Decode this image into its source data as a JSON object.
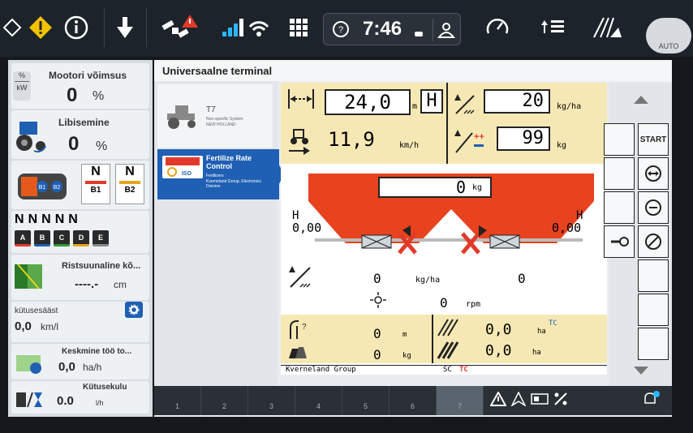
{
  "topbar": {
    "time": "7:46",
    "auto_label": "AUTO"
  },
  "left_panel": {
    "engine_load": {
      "title": "Mootori võimsus",
      "value": "0",
      "unit": "%",
      "badge_top": "%",
      "badge_bottom": "kW"
    },
    "slip": {
      "title": "Libisemine",
      "value": "0",
      "unit": "%"
    },
    "brakes": {
      "b1_label": "B1",
      "b2_label": "B2",
      "b1_state": "N",
      "b2_state": "N",
      "badge1": "B1",
      "badge2": "B2"
    },
    "remotes": {
      "states": [
        "N",
        "N",
        "N",
        "N",
        "N"
      ],
      "letters": [
        "A",
        "B",
        "C",
        "D",
        "E"
      ]
    },
    "crosstrack": {
      "title": "Ristsuunaline kõ...",
      "value": "----.-",
      "unit": "cm"
    },
    "fuel_setting": {
      "title": "kütusesääst",
      "value": "0,0",
      "unit": "km/l"
    },
    "avg_work": {
      "title": "Keskmine töö to...",
      "value": "0,0",
      "unit": "ha/h"
    },
    "fuel_use": {
      "title": "Kütusekulu",
      "value": "0.0",
      "unit": "l/h"
    }
  },
  "main": {
    "header": "Universaalne terminal",
    "apps": [
      {
        "name": "T7",
        "line1": "Non-specific System",
        "line2": "NEW HOLLAND"
      },
      {
        "name": "Fertilize Rate Control",
        "line1": "Fertilizers",
        "line2": "Kverneland Group, Electronics Division",
        "badge": "ISO"
      }
    ]
  },
  "terminal": {
    "width_value": "24,0",
    "width_unit": "m",
    "width_mode": "H",
    "speed_value": "11,9",
    "speed_unit": "km/h",
    "rate_value": "20",
    "rate_unit": "kg/ha",
    "rate2_value": "99",
    "rate2_unit": "kg",
    "hopper_value": "0",
    "hopper_unit": "kg",
    "left_H": "H",
    "left_H_val": "0,00",
    "right_H": "H",
    "right_H_val": "0,00",
    "applied_rate": "0",
    "applied_rate_unit": "kg/ha",
    "applied_right": "0",
    "disc_speed": "0",
    "disc_unit": "rpm",
    "dist_value": "0",
    "dist_unit": "m",
    "mass_value": "0",
    "mass_unit": "kg",
    "area1_value": "0,0",
    "area1_unit": "ha",
    "area1_tag": "TC",
    "area2_value": "0,0",
    "area2_unit": "ha",
    "footer_brand": "Kverneland Group",
    "footer_sc": "SC",
    "footer_tc": "TC"
  },
  "softkeys": {
    "start": "START"
  },
  "pages": [
    "1",
    "2",
    "3",
    "4",
    "5",
    "6",
    "7"
  ]
}
